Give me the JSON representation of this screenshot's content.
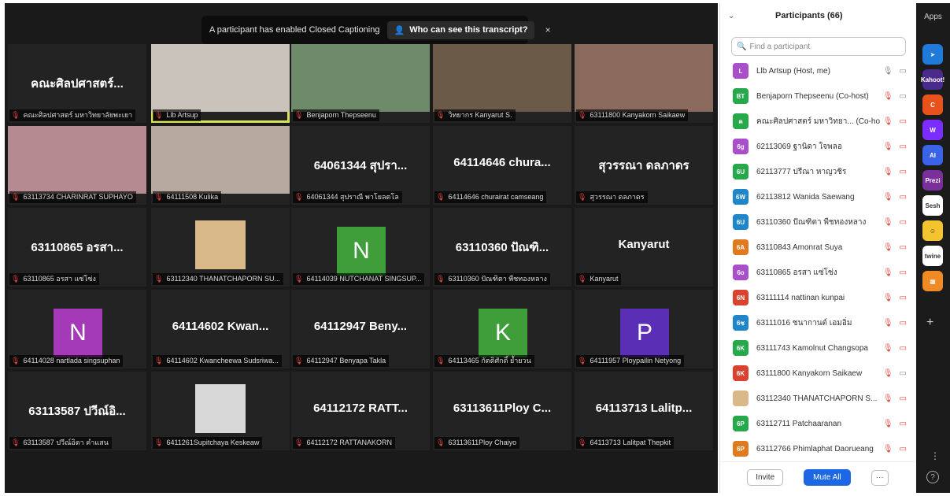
{
  "banner": {
    "caption_text": "A participant has enabled Closed Captioning",
    "who_button": "Who can see this transcript?",
    "close": "×"
  },
  "tiles": [
    {
      "big": "คณะศิลปศาสตร์...",
      "label": "คณะศิลปศาสตร์ มหาวิทยาลัยพะเยา"
    },
    {
      "big": "",
      "label": "Llb Artsup",
      "photo": "#c9c3bb",
      "active": true
    },
    {
      "big": "",
      "label": "Benjaporn Thepseenu",
      "photo": "#6f8a6a"
    },
    {
      "big": "",
      "label": "วิทยากร Kanyarut S.",
      "photo": "#6c5a48"
    },
    {
      "big": "",
      "label": "63111800 Kanyakorn Saikaew",
      "photo": "#8b6a5e"
    },
    {
      "big": "",
      "label": "63113734 CHARINRAT SUPHAYO",
      "photo": "#b58a90"
    },
    {
      "big": "",
      "label": "64111508 Kulika",
      "photo": "#b6aaa0"
    },
    {
      "big": "64061344 สุปรา...",
      "label": "64061344 สุปราณี พาโยลตโล"
    },
    {
      "big": "64114646 chura...",
      "label": "64114646 churairat camseang"
    },
    {
      "big": "สุวรรณา ดลภาดร",
      "label": "สุวรรณา ดลภาดร"
    },
    {
      "big": "63110865 อรสา...",
      "label": "63110865 อรสา แซ่โซ่ง"
    },
    {
      "big": "",
      "label": "63112340 THANATCHAPORN SU...",
      "photo": "#d9b98a",
      "photo_small": true
    },
    {
      "big": "",
      "label": "64114039 NUTCHANAT SINGSUP...",
      "avatar": "N",
      "avatar_color": "#3f9d3a"
    },
    {
      "big": "63110360 ปัณฑิ...",
      "label": "63110360 ปัณฑิตา พืชทองหลาง"
    },
    {
      "big": "Kanyarut",
      "label": "Kanyarut"
    },
    {
      "big": "",
      "label": "64114028 nartlada singsuphan",
      "avatar": "N",
      "avatar_color": "#a53ab8"
    },
    {
      "big": "64114602 Kwan...",
      "label": "64114602 Kwancheewa Sudsriwa..."
    },
    {
      "big": "64112947 Beny...",
      "label": "64112947 Benyapa Takla"
    },
    {
      "big": "",
      "label": "64113465 กัตติศักดิ์ ย้ำยวน",
      "avatar": "K",
      "avatar_color": "#3f9d3a"
    },
    {
      "big": "",
      "label": "64111957 Ploypailin Netyong",
      "avatar": "P",
      "avatar_color": "#5b2fb5"
    },
    {
      "big": "63113587 ปวีณ์อิ...",
      "label": "63113587 ปวีณ์อิดา คำแสน"
    },
    {
      "big": "",
      "label": "6411261Supitchaya Keskeaw",
      "photo": "#d8d8d8",
      "photo_small": true
    },
    {
      "big": "64112172 RATT...",
      "label": "64112172 RATTANAKORN"
    },
    {
      "big": "63113611Ploy C...",
      "label": "63113611Ploy Chaiyo"
    },
    {
      "big": "64113713 Lalitp...",
      "label": "64113713 Lalitpat Thepkit"
    }
  ],
  "participants": {
    "title": "Participants (66)",
    "search_placeholder": "Find a participant",
    "list": [
      {
        "initials": "L",
        "color": "#a84fc9",
        "name": "Llb Artsup (Host, me)",
        "muted": false
      },
      {
        "initials": "BT",
        "color": "#27a84a",
        "name": "Benjaporn Thepseenu (Co-host)",
        "muted": true,
        "video_on": true
      },
      {
        "initials": "ค",
        "color": "#27a84a",
        "name": "คณะศิลปศาสตร์ มหาวิทยา... (Co-host)",
        "muted": true
      },
      {
        "initials": "6g",
        "color": "#a84fc9",
        "name": "62113069 ฐานิดา ใจพลอ",
        "muted": true
      },
      {
        "initials": "6U",
        "color": "#27a84a",
        "name": "62113777 ปรีณา หาญวชิร",
        "muted": true
      },
      {
        "initials": "6W",
        "color": "#1f86c9",
        "name": "62113812 Wanida Saewang",
        "muted": true
      },
      {
        "initials": "6U",
        "color": "#1f86c9",
        "name": "63110360 ปัณฑิตา พืชทองหลาง",
        "muted": true
      },
      {
        "initials": "6A",
        "color": "#e07a1f",
        "name": "63110843 Amonrat Suya",
        "muted": true
      },
      {
        "initials": "6o",
        "color": "#a84fc9",
        "name": "63110865 อรสา แซ่โซ่ง",
        "muted": true
      },
      {
        "initials": "6N",
        "color": "#d9422e",
        "name": "63111114 nattinan kunpai",
        "muted": true
      },
      {
        "initials": "6ช",
        "color": "#1f86c9",
        "name": "63111016 ชนากานต์ เอมอิ่ม",
        "muted": true
      },
      {
        "initials": "6K",
        "color": "#27a84a",
        "name": "63111743 Kamolnut Changsopa",
        "muted": true
      },
      {
        "initials": "6K",
        "color": "#d9422e",
        "name": "63111800 Kanyakorn Saikaew",
        "muted": true,
        "video_on": true
      },
      {
        "initials": "",
        "color": "#d9b98a",
        "name": "63112340 THANATCHAPORN S...",
        "muted": true
      },
      {
        "initials": "6P",
        "color": "#27a84a",
        "name": "63112711 Patchaaranan",
        "muted": true
      },
      {
        "initials": "6P",
        "color": "#e07a1f",
        "name": "63112766 Phimlaphat Daorueang",
        "muted": true
      }
    ],
    "invite": "Invite",
    "mute_all": "Mute All",
    "more": "···"
  },
  "apps": {
    "title": "Apps",
    "items": [
      {
        "name": "arrow-app",
        "color": "#1f7ad9",
        "text": "➤"
      },
      {
        "name": "kahoot-app",
        "color": "#4a2a8a",
        "text": "Kahoot!"
      },
      {
        "name": "c-app",
        "color": "#e8531c",
        "text": "C"
      },
      {
        "name": "w-app",
        "color": "#7b2cff",
        "text": "W"
      },
      {
        "name": "ai-app",
        "color": "#3a63e8",
        "text": "AI"
      },
      {
        "name": "prezi-app",
        "color": "#7a2f9a",
        "text": "Prezi"
      },
      {
        "name": "sesh-app",
        "color": "#ffffff",
        "text": "Sesh"
      },
      {
        "name": "smile-app",
        "color": "#f4c430",
        "text": "☺"
      },
      {
        "name": "twine-app",
        "color": "#ffffff",
        "text": "twine"
      },
      {
        "name": "blocks-app",
        "color": "#f08a24",
        "text": "▦"
      }
    ],
    "help": "?"
  }
}
